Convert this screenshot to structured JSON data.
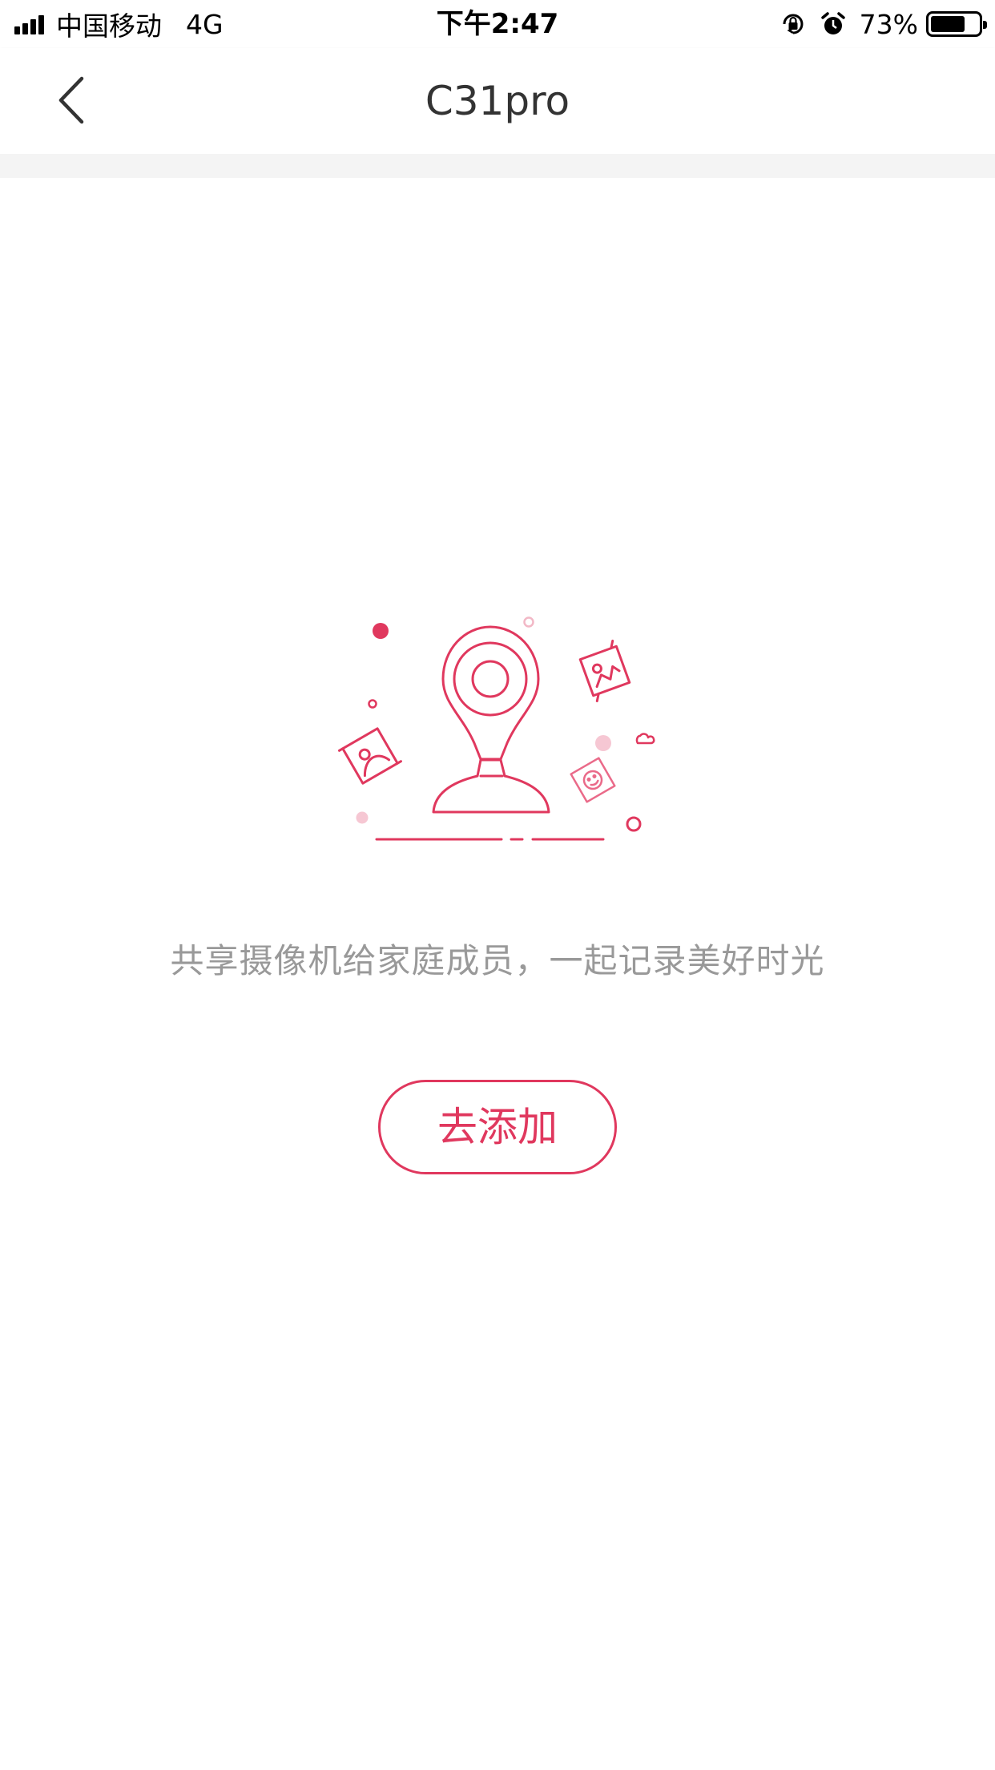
{
  "status_bar": {
    "carrier": "中国移动",
    "network": "4G",
    "time": "下午2:47",
    "battery_percent": "73%",
    "battery_level": 0.73,
    "icons": [
      "signal-icon",
      "orientation-lock-icon",
      "alarm-icon",
      "battery-icon"
    ]
  },
  "nav": {
    "title": "C31pro",
    "back_icon": "chevron-left-icon"
  },
  "main": {
    "illustration": "camera-share-illustration",
    "message": "共享摄像机给家庭成员，一起记录美好时光",
    "add_button_label": "去添加"
  },
  "colors": {
    "accent": "#e0385e",
    "accent_light": "#f2b8c6",
    "text_secondary": "#999999",
    "title": "#333333"
  }
}
